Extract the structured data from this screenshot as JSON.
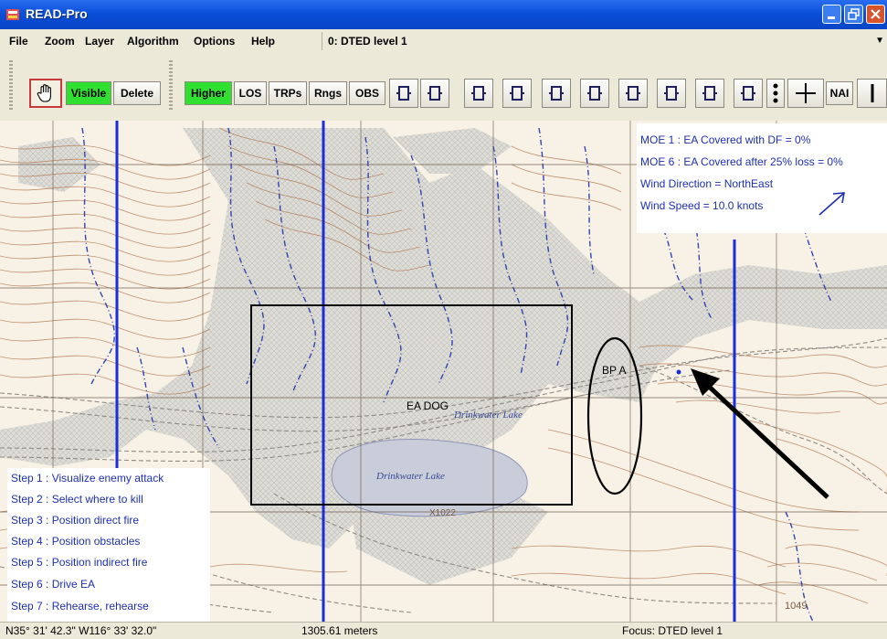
{
  "window": {
    "title": "READ-Pro"
  },
  "menu": {
    "items": [
      "File",
      "Zoom",
      "Layer",
      "Algorithm",
      "Options",
      "Help"
    ],
    "layer_selected": "0: DTED level 1"
  },
  "toolbar": {
    "visible_label": "Visible",
    "delete_label": "Delete",
    "higher_label": "Higher",
    "los_label": "LOS",
    "trps_label": "TRPs",
    "rngs_label": "Rngs",
    "obs_label": "OBS",
    "nai_label": "NAI",
    "square_tool_count": 10,
    "active_color": "#30e030"
  },
  "moe": {
    "line1": "MOE 1 : EA Covered with DF =  0%",
    "line2": "MOE 6 : EA Covered after 25% loss =  0%",
    "wind_direction": "Wind Direction = NorthEast",
    "wind_speed": "Wind Speed = 10.0 knots",
    "wind_arrow_icon": "arrow-northeast-icon"
  },
  "map_labels": {
    "ea": "EA DOG",
    "bp": "BP A",
    "lake1": "Drinkwater Lake",
    "lake2": "Drinkwater Lake",
    "elev1": "1049",
    "elev2": "X1022"
  },
  "steps": [
    "Step 1 :  Visualize enemy attack",
    "Step 2 :  Select where to kill",
    "Step 3 :  Position direct fire",
    "Step 4 :  Position obstacles",
    "Step 5 :  Position indirect fire",
    "Step 6 :  Drive EA",
    "Step 7 :  Rehearse, rehearse"
  ],
  "status": {
    "coords": "N35° 31' 42.3\"  W116° 33' 32.0\"",
    "distance": "1305.61 meters",
    "focus": "Focus:  DTED level 1"
  },
  "colors": {
    "text_blue": "#1e2fb0",
    "grid_line_blue": "#1a2fd6",
    "contour_brown": "#b57a52"
  }
}
